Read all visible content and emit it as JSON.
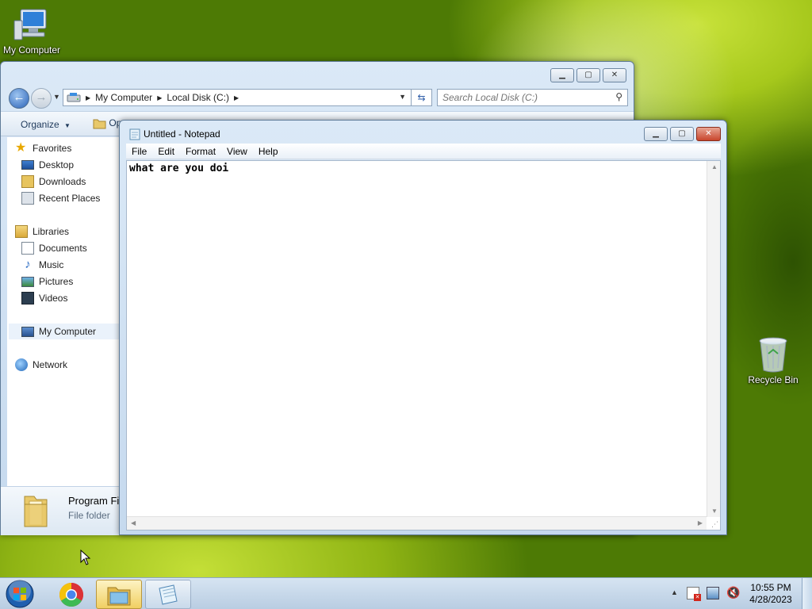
{
  "desktop": {
    "icons": [
      {
        "label": "My Computer",
        "icon": "computer-icon"
      },
      {
        "label": "Recycle Bin",
        "icon": "recycle-bin-icon"
      }
    ]
  },
  "explorer": {
    "breadcrumb": [
      "My Computer",
      "Local Disk (C:)"
    ],
    "search_placeholder": "Search Local Disk (C:)",
    "commands": {
      "organize": "Organize",
      "open": "Op"
    },
    "nav": {
      "favorites": "Favorites",
      "favorites_items": [
        "Desktop",
        "Downloads",
        "Recent Places"
      ],
      "libraries": "Libraries",
      "libraries_items": [
        "Documents",
        "Music",
        "Pictures",
        "Videos"
      ],
      "computer": "My Computer",
      "network": "Network"
    },
    "details": {
      "name": "Program Fi",
      "type": "File folder"
    }
  },
  "notepad": {
    "title": "Untitled - Notepad",
    "menu": [
      "File",
      "Edit",
      "Format",
      "View",
      "Help"
    ],
    "content": "what are you doi"
  },
  "taskbar": {
    "pinned": [
      "start-orb-icon",
      "chrome-icon",
      "explorer-icon",
      "notepad-icon"
    ],
    "tray_icons": [
      "show-hidden-icons-arrow",
      "action-center-flag-icon",
      "network-icon",
      "volume-muted-icon"
    ],
    "time": "10:55 PM",
    "date": "4/28/2023"
  }
}
